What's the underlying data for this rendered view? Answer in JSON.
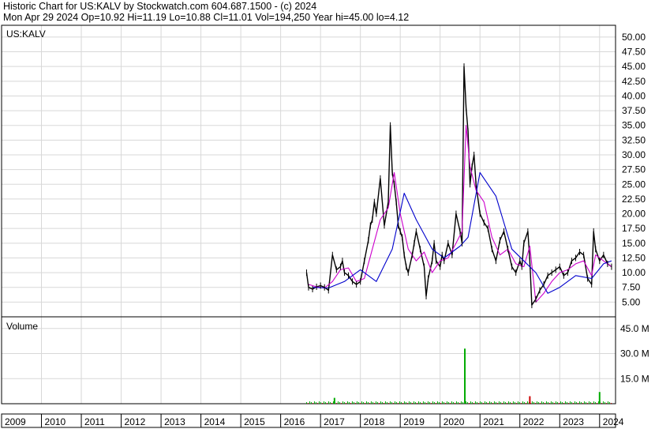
{
  "header": {
    "line1": "Historic Chart for US:KALV by Stockwatch.com 604.687.1500 - (c) 2024",
    "line2": "Mon Apr 29 2024   Op=10.92  Hi=11.19  Lo=10.88  Cl=11.01  Vol=194,250  Year hi=45.00  lo=4.12"
  },
  "colors": {
    "price": "#000000",
    "ma_short": "#cc00cc",
    "ma_long": "#0000cc",
    "vol_up": "#00aa00",
    "vol_down": "#cc0000",
    "grid": "#d8d8d8"
  },
  "chart_data": [
    {
      "type": "line",
      "title": "US:KALV",
      "ylim": [
        2.5,
        52
      ],
      "y_ticks": [
        "50.00",
        "47.50",
        "45.00",
        "42.50",
        "40.00",
        "37.50",
        "35.00",
        "32.50",
        "30.00",
        "27.50",
        "25.00",
        "22.50",
        "20.00",
        "17.50",
        "15.00",
        "12.50",
        "10.00",
        "7.50",
        "5.00"
      ],
      "y_tick_values": [
        50,
        47.5,
        45,
        42.5,
        40,
        37.5,
        35,
        32.5,
        30,
        27.5,
        25,
        22.5,
        20,
        17.5,
        15,
        12.5,
        10,
        7.5,
        5
      ],
      "x_ticks": [
        "2009",
        "2010",
        "2011",
        "2012",
        "2013",
        "2014",
        "2015",
        "2016",
        "2017",
        "2018",
        "2019",
        "2020",
        "2021",
        "2022",
        "2023",
        "2024"
      ],
      "x_tick_values": [
        2009,
        2010,
        2011,
        2012,
        2013,
        2014,
        2015,
        2016,
        2017,
        2018,
        2019,
        2020,
        2021,
        2022,
        2023,
        2024
      ],
      "xlim": [
        2009,
        2024.4
      ],
      "series": [
        {
          "x": [
            2016.65,
            2016.7,
            2016.8,
            2016.9,
            2017.0,
            2017.1,
            2017.2,
            2017.3,
            2017.4,
            2017.5,
            2017.55,
            2017.6,
            2017.7,
            2017.8,
            2017.9,
            2018.0,
            2018.1,
            2018.2,
            2018.25,
            2018.3,
            2018.35,
            2018.4,
            2018.5,
            2018.6,
            2018.7,
            2018.75,
            2018.8,
            2018.85,
            2018.9,
            2018.95,
            2019.0,
            2019.05,
            2019.1,
            2019.15,
            2019.2,
            2019.3,
            2019.35,
            2019.4,
            2019.5,
            2019.6,
            2019.65,
            2019.7,
            2019.8,
            2019.85,
            2019.9,
            2020.0,
            2020.05,
            2020.1,
            2020.2,
            2020.3,
            2020.4,
            2020.5,
            2020.55,
            2020.6,
            2020.65,
            2020.7,
            2020.75,
            2020.8,
            2020.85,
            2020.9,
            2021.0,
            2021.1,
            2021.2,
            2021.3,
            2021.4,
            2021.5,
            2021.6,
            2021.7,
            2021.8,
            2021.9,
            2022.0,
            2022.05,
            2022.1,
            2022.2,
            2022.25,
            2022.3,
            2022.4,
            2022.5,
            2022.6,
            2022.7,
            2022.8,
            2022.9,
            2023.0,
            2023.1,
            2023.2,
            2023.3,
            2023.4,
            2023.5,
            2023.6,
            2023.7,
            2023.8,
            2023.85,
            2023.9,
            2024.0,
            2024.1,
            2024.2,
            2024.3
          ],
          "y": [
            10.0,
            7.5,
            7.2,
            7.6,
            7.8,
            7.5,
            7.0,
            13.0,
            10.5,
            11.0,
            12.0,
            10.0,
            9.5,
            8.5,
            8.0,
            8.5,
            12.0,
            15.5,
            18.0,
            19.0,
            22.0,
            20.0,
            26.0,
            18.0,
            22.0,
            35.0,
            27.0,
            25.0,
            22.0,
            18.0,
            17.0,
            16.0,
            13.0,
            11.0,
            10.0,
            13.0,
            15.0,
            17.0,
            14.0,
            11.0,
            6.0,
            9.0,
            12.0,
            15.0,
            12.0,
            11.0,
            13.0,
            12.0,
            15.0,
            13.0,
            20.0,
            17.0,
            15.0,
            45.0,
            38.0,
            34.0,
            25.0,
            28.0,
            30.0,
            25.0,
            20.0,
            18.5,
            17.5,
            14.0,
            12.0,
            15.5,
            17.0,
            14.0,
            11.0,
            10.0,
            12.0,
            11.0,
            15.0,
            17.0,
            12.0,
            4.5,
            5.5,
            7.0,
            8.0,
            9.5,
            10.0,
            10.5,
            11.0,
            9.5,
            10.0,
            12.0,
            12.5,
            13.5,
            13.0,
            9.0,
            8.0,
            17.0,
            14.0,
            12.0,
            13.0,
            11.5,
            11.0
          ]
        },
        {
          "x": [
            2016.7,
            2016.9,
            2017.1,
            2017.3,
            2017.5,
            2017.7,
            2017.9,
            2018.1,
            2018.3,
            2018.5,
            2018.7,
            2018.85,
            2019.0,
            2019.2,
            2019.4,
            2019.6,
            2019.8,
            2020.0,
            2020.2,
            2020.4,
            2020.55,
            2020.65,
            2020.75,
            2020.9,
            2021.1,
            2021.3,
            2021.5,
            2021.7,
            2021.9,
            2022.1,
            2022.25,
            2022.4,
            2022.6,
            2022.8,
            2023.0,
            2023.2,
            2023.4,
            2023.6,
            2023.8,
            2023.9,
            2024.1,
            2024.3
          ],
          "y": [
            8.0,
            7.6,
            7.4,
            8.5,
            10.5,
            10.8,
            8.5,
            9.0,
            14.0,
            19.0,
            21.0,
            27.0,
            20.0,
            14.0,
            12.0,
            13.5,
            10.0,
            12.0,
            12.5,
            15.0,
            17.0,
            35.0,
            28.0,
            24.0,
            22.0,
            16.0,
            13.0,
            14.0,
            11.5,
            11.0,
            14.5,
            5.0,
            6.5,
            8.5,
            10.0,
            10.5,
            11.5,
            12.0,
            9.5,
            13.0,
            12.0,
            11.0
          ]
        },
        {
          "x": [
            2016.8,
            2017.2,
            2017.6,
            2018.0,
            2018.4,
            2018.8,
            2019.1,
            2019.4,
            2019.8,
            2020.1,
            2020.5,
            2020.7,
            2021.0,
            2021.4,
            2021.8,
            2022.1,
            2022.4,
            2022.7,
            2023.0,
            2023.4,
            2023.8,
            2024.1,
            2024.3
          ],
          "y": [
            7.5,
            7.4,
            8.5,
            10.5,
            8.5,
            14.0,
            23.5,
            19.0,
            14.0,
            12.5,
            14.5,
            16.0,
            27.0,
            23.0,
            14.0,
            12.0,
            10.0,
            6.5,
            7.5,
            9.5,
            9.0,
            11.5,
            12.0
          ]
        }
      ]
    },
    {
      "type": "bar",
      "title": "Volume",
      "ylim": [
        0,
        52
      ],
      "y_ticks": [
        "45.0 M",
        "30.0 M",
        "15.0 M"
      ],
      "y_tick_values": [
        45,
        30,
        15
      ],
      "spikes": {
        "x": [
          2017.35,
          2020.62,
          2022.25,
          2024.0
        ],
        "y": [
          3.5,
          33.0,
          4.5,
          7.0
        ]
      },
      "x_range": [
        2016.65,
        2024.3
      ]
    }
  ]
}
